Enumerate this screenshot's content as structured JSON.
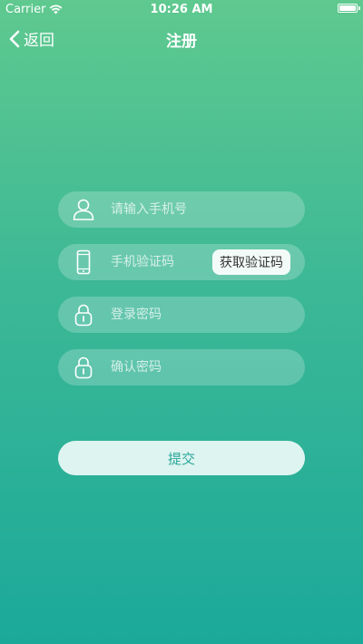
{
  "status_bar": {
    "carrier": "Carrier",
    "time": "10:26 AM"
  },
  "nav": {
    "back_label": "返回",
    "title": "注册"
  },
  "form": {
    "phone_placeholder": "请输入手机号",
    "code_placeholder": "手机验证码",
    "get_code_label": "获取验证码",
    "password_placeholder": "登录密码",
    "confirm_placeholder": "确认密码",
    "submit_label": "提交"
  },
  "colors": {
    "gradient_top": "#5fc98f",
    "gradient_bottom": "#1ba99a",
    "submit_text": "#2aa89a"
  }
}
